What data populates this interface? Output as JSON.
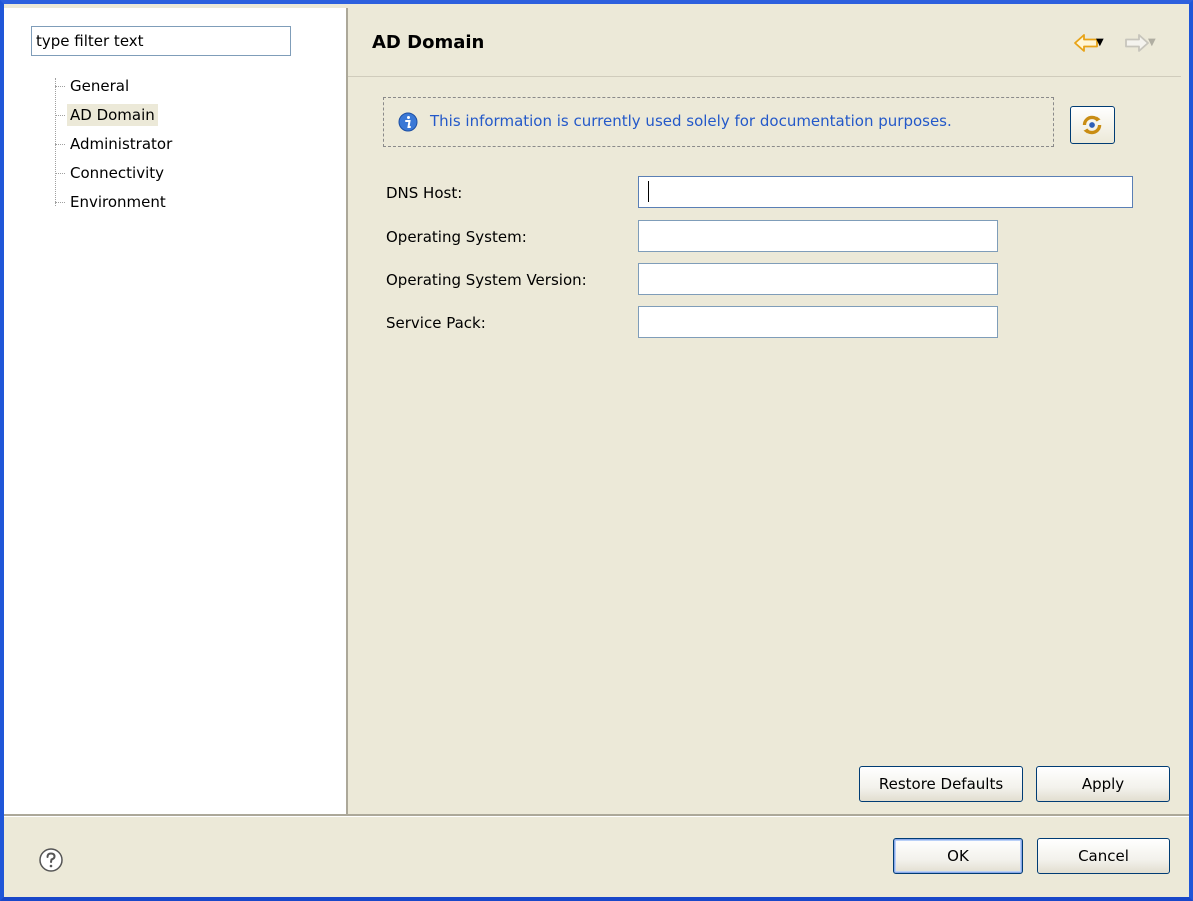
{
  "filter": {
    "placeholder": "type filter text",
    "value": "type filter text"
  },
  "tree": {
    "items": [
      {
        "label": "General",
        "selected": false
      },
      {
        "label": "AD Domain",
        "selected": true
      },
      {
        "label": "Administrator",
        "selected": false
      },
      {
        "label": "Connectivity",
        "selected": false
      },
      {
        "label": "Environment",
        "selected": false
      }
    ]
  },
  "header": {
    "title": "AD Domain",
    "back_icon": "back-arrow-icon",
    "forward_icon": "forward-arrow-icon"
  },
  "info": {
    "icon": "info-icon",
    "text": "This information is currently used solely for documentation purposes."
  },
  "refresh": {
    "icon": "refresh-icon"
  },
  "form": {
    "dns_host": {
      "label": "DNS Host:",
      "value": ""
    },
    "os": {
      "label": "Operating System:",
      "value": ""
    },
    "os_version": {
      "label": "Operating System Version:",
      "value": ""
    },
    "service_pack": {
      "label": "Service Pack:",
      "value": ""
    }
  },
  "buttons": {
    "restore_defaults": "Restore Defaults",
    "apply": "Apply",
    "ok": "OK",
    "cancel": "Cancel"
  },
  "help": {
    "icon": "help-icon"
  },
  "colors": {
    "window_border": "#1f56d8",
    "dialog_bg": "#ece9d8",
    "info_text": "#2459c9",
    "back_arrow": "#e8a317"
  }
}
